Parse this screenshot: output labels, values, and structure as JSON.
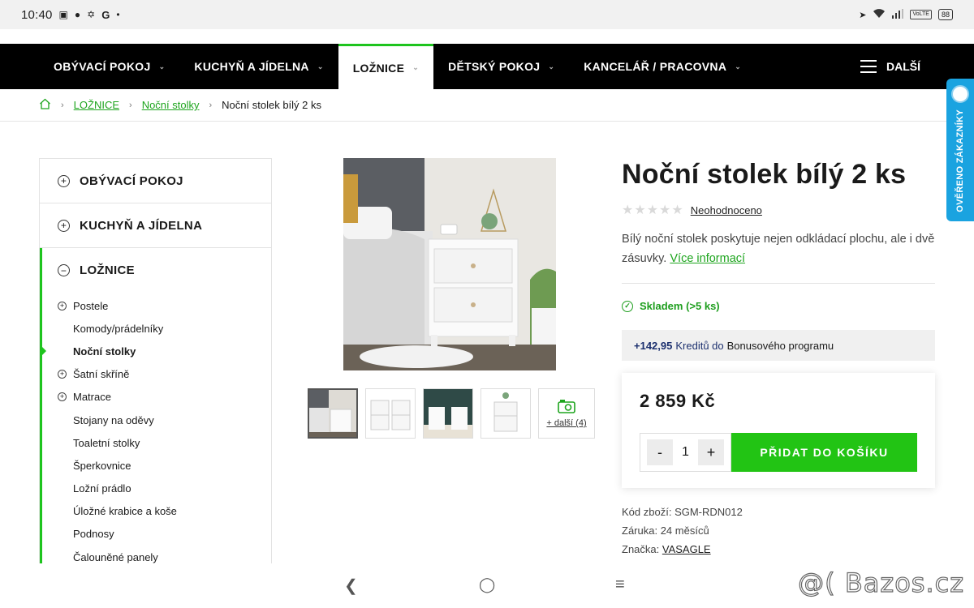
{
  "status": {
    "time": "10:40",
    "icons": [
      "train-icon",
      "steam-icon",
      "puzzle-icon",
      "google-icon",
      "dot-icon"
    ],
    "volte": "VoLTE",
    "battery": "88"
  },
  "nav": {
    "items": [
      {
        "label": "OBÝVACÍ POKOJ",
        "active": false
      },
      {
        "label": "KUCHYŇ A JÍDELNA",
        "active": false
      },
      {
        "label": "LOŽNICE",
        "active": true
      },
      {
        "label": "DĚTSKÝ POKOJ",
        "active": false
      },
      {
        "label": "KANCELÁŘ / PRACOVNA",
        "active": false
      }
    ],
    "more": "DALŠÍ"
  },
  "breadcrumb": {
    "l1": "LOŽNICE",
    "l2": "Noční stolky",
    "current": "Noční stolek bílý 2 ks"
  },
  "sidebar": {
    "c1": "OBÝVACÍ POKOJ",
    "c2": "KUCHYŇ A JÍDELNA",
    "c3": "LOŽNICE",
    "sub": [
      "Postele",
      "Komody/prádelníky",
      "Noční stolky",
      "Šatní skříně",
      "Matrace",
      "Stojany na oděvy",
      "Toaletní stolky",
      "Šperkovnice",
      "Ložní prádlo",
      "Úložné krabice a koše",
      "Podnosy",
      "Čalouněné panely"
    ]
  },
  "gallery": {
    "more_label": "+ další (4)"
  },
  "product": {
    "title": "Noční stolek bílý 2 ks",
    "rating_label": "Neohodnoceno",
    "desc": "Bílý noční stolek poskytuje nejen odkládací plochu, ale i dvě zásuvky.",
    "more_info": "Více informací",
    "stock": "Skladem (>5 ks)",
    "bonus_amount": "+142,95",
    "bonus_mid": "Kreditů do",
    "bonus_end": "Bonusového programu",
    "price": "2 859 Kč",
    "qty": "1",
    "qty_minus": "-",
    "qty_plus": "+",
    "add_to_cart": "PŘIDAT DO KOŠÍKU",
    "code_label": "Kód zboží:",
    "code": "SGM-RDN012",
    "warranty_label": "Záruka:",
    "warranty": "24 měsíců",
    "brand_label": "Značka:",
    "brand": "VASAGLE"
  },
  "badge": {
    "text": "OVĚŘENO ZÁKAZNÍKY"
  },
  "watermark": "@( Bazos.cz",
  "colors": {
    "accent": "#22c414",
    "nav_bg": "#000000",
    "bonus_blue": "#1b2f6e",
    "badge_blue": "#1aa3e0"
  }
}
